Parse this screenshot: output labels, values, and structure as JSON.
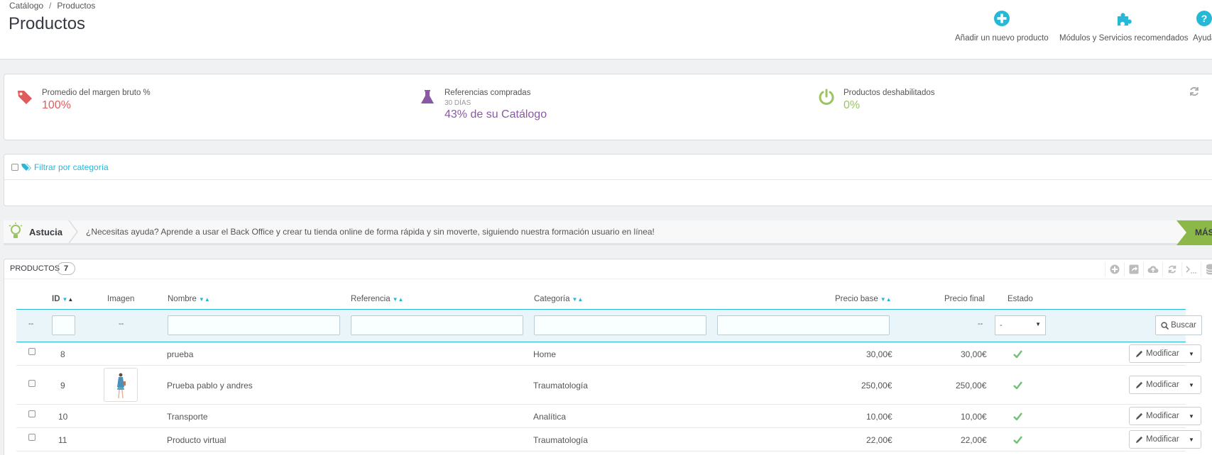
{
  "breadcrumb": {
    "parent": "Catálogo",
    "separator": "/",
    "current": "Productos"
  },
  "page_title": "Productos",
  "toolbar": {
    "add_product": "Añadir un nuevo producto",
    "modules": "Módulos y Servicios recomendados",
    "help": "Ayuda"
  },
  "kpis": [
    {
      "title": "Promedio del margen bruto %",
      "subtitle": "",
      "value": "100%",
      "color": "#e05c5c",
      "icon": "tag-icon"
    },
    {
      "title": "Referencias compradas",
      "subtitle": "30 DÍAS",
      "value": "43% de su Catálogo",
      "color": "#8a59a6",
      "icon": "flask-icon"
    },
    {
      "title": "Productos deshabilitados",
      "subtitle": "",
      "value": "0%",
      "color": "#9bc461",
      "icon": "power-icon"
    }
  ],
  "filter_category": {
    "label": "Filtrar por categoría"
  },
  "tip": {
    "label": "Astucia",
    "text": "¿Necesitas ayuda? Aprende a usar el Back Office y crear tu tienda online de forma rápida y sin moverte, siguiendo nuestra formación usuario en línea!",
    "more": "MÁS"
  },
  "list": {
    "title": "Productos",
    "count": "7",
    "columns": {
      "id": "ID",
      "image": "Imagen",
      "name": "Nombre",
      "reference": "Referencia",
      "category": "Categoría",
      "base_price": "Precio base",
      "final_price": "Precio final",
      "status": "Estado"
    },
    "filters": {
      "dash": "--",
      "status_select": "-",
      "search_button": "Buscar"
    },
    "rows": [
      {
        "id": "8",
        "name": "prueba",
        "category": "Home",
        "base_price": "30,00€",
        "final_price": "30,00€"
      },
      {
        "id": "9",
        "name": "Prueba pablo y andres",
        "category": "Traumatología",
        "base_price": "250,00€",
        "final_price": "250,00€"
      },
      {
        "id": "10",
        "name": "Transporte",
        "category": "Analítica",
        "base_price": "10,00€",
        "final_price": "10,00€"
      },
      {
        "id": "11",
        "name": "Producto virtual",
        "category": "Traumatología",
        "base_price": "22,00€",
        "final_price": "22,00€"
      }
    ],
    "edit_button": "Modificar"
  },
  "colors": {
    "accent": "#25b9d7",
    "text": "#555555",
    "success": "#72c279"
  }
}
